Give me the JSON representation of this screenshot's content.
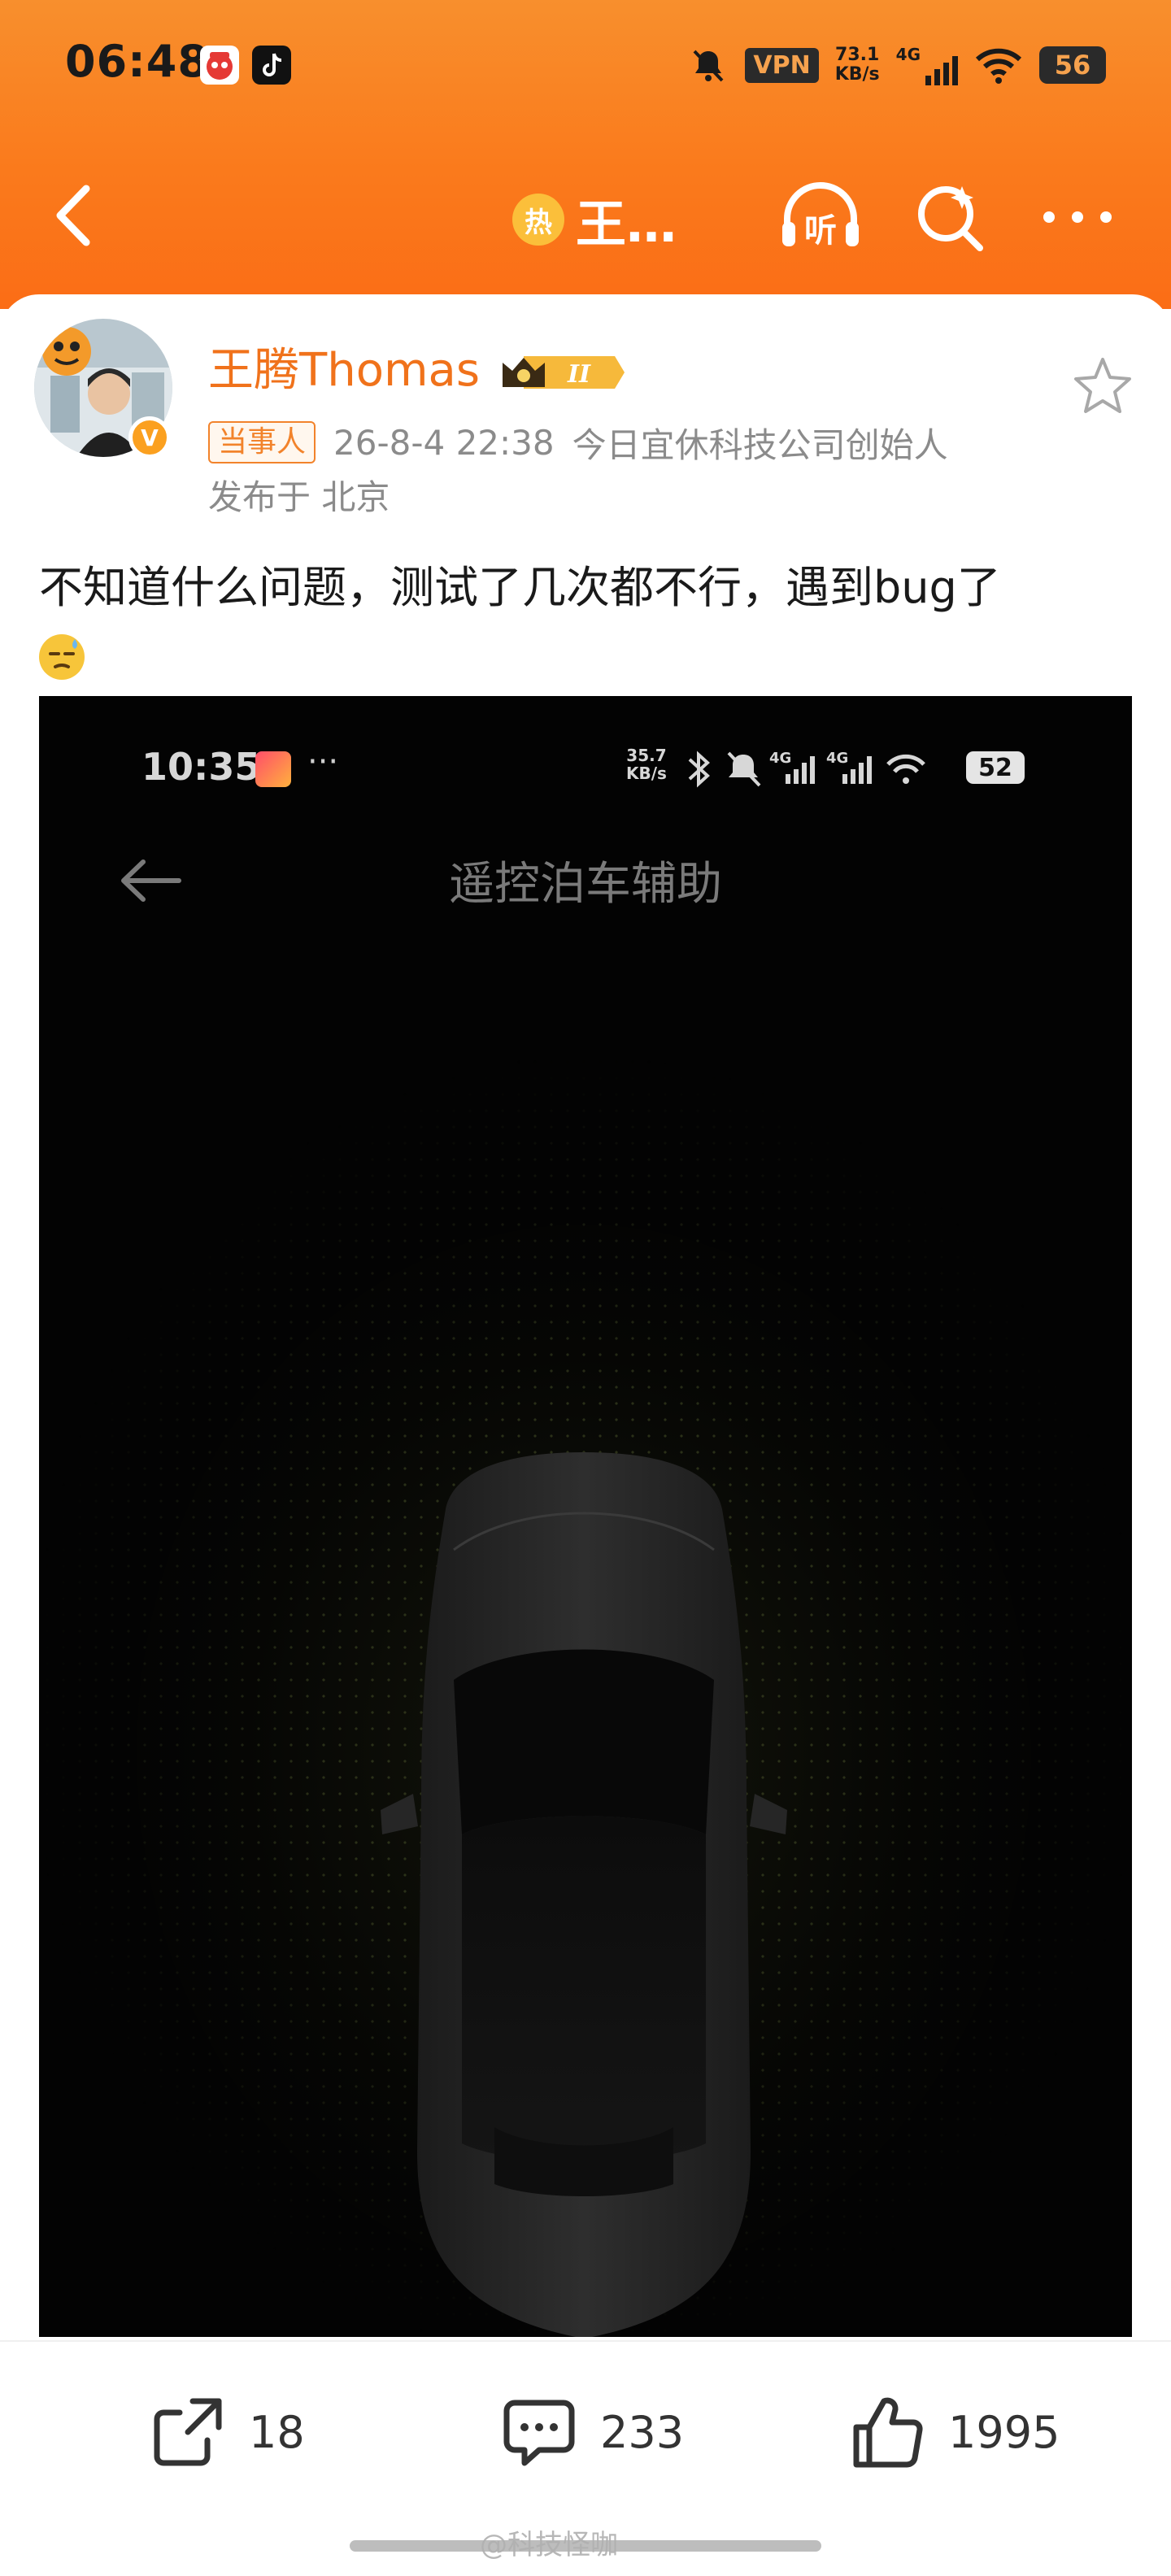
{
  "status_bar": {
    "time": "06:48",
    "vpn": "VPN",
    "net_speed_value": "73.1",
    "net_speed_unit": "KB/s",
    "network": "4G",
    "battery": "56"
  },
  "nav": {
    "hot_label": "热",
    "title": "王…",
    "listen_icon": "headphones-listen-icon",
    "search_icon": "search-icon",
    "more_icon": "more-icon"
  },
  "post": {
    "username": "王腾Thomas",
    "tag": "当事人",
    "timestamp": "26-8-4 22:38",
    "bio": "今日宜休科技公司创始人",
    "location": "发布于 北京",
    "text": "不知道什么问题，测试了几次都不行，遇到bug了",
    "vip_level": "II"
  },
  "screenshot": {
    "time": "10:35",
    "dots": "···",
    "net_speed_value": "35.7",
    "net_speed_unit": "KB/s",
    "battery": "52",
    "title": "遥控泊车辅助"
  },
  "actions": {
    "share_count": "18",
    "comment_count": "233",
    "like_count": "1995"
  },
  "watermark": "@科技怪咖",
  "colors": {
    "header_orange": "#fa7a1c",
    "username_orange": "#f0721b",
    "tag_orange": "#f2832b"
  }
}
